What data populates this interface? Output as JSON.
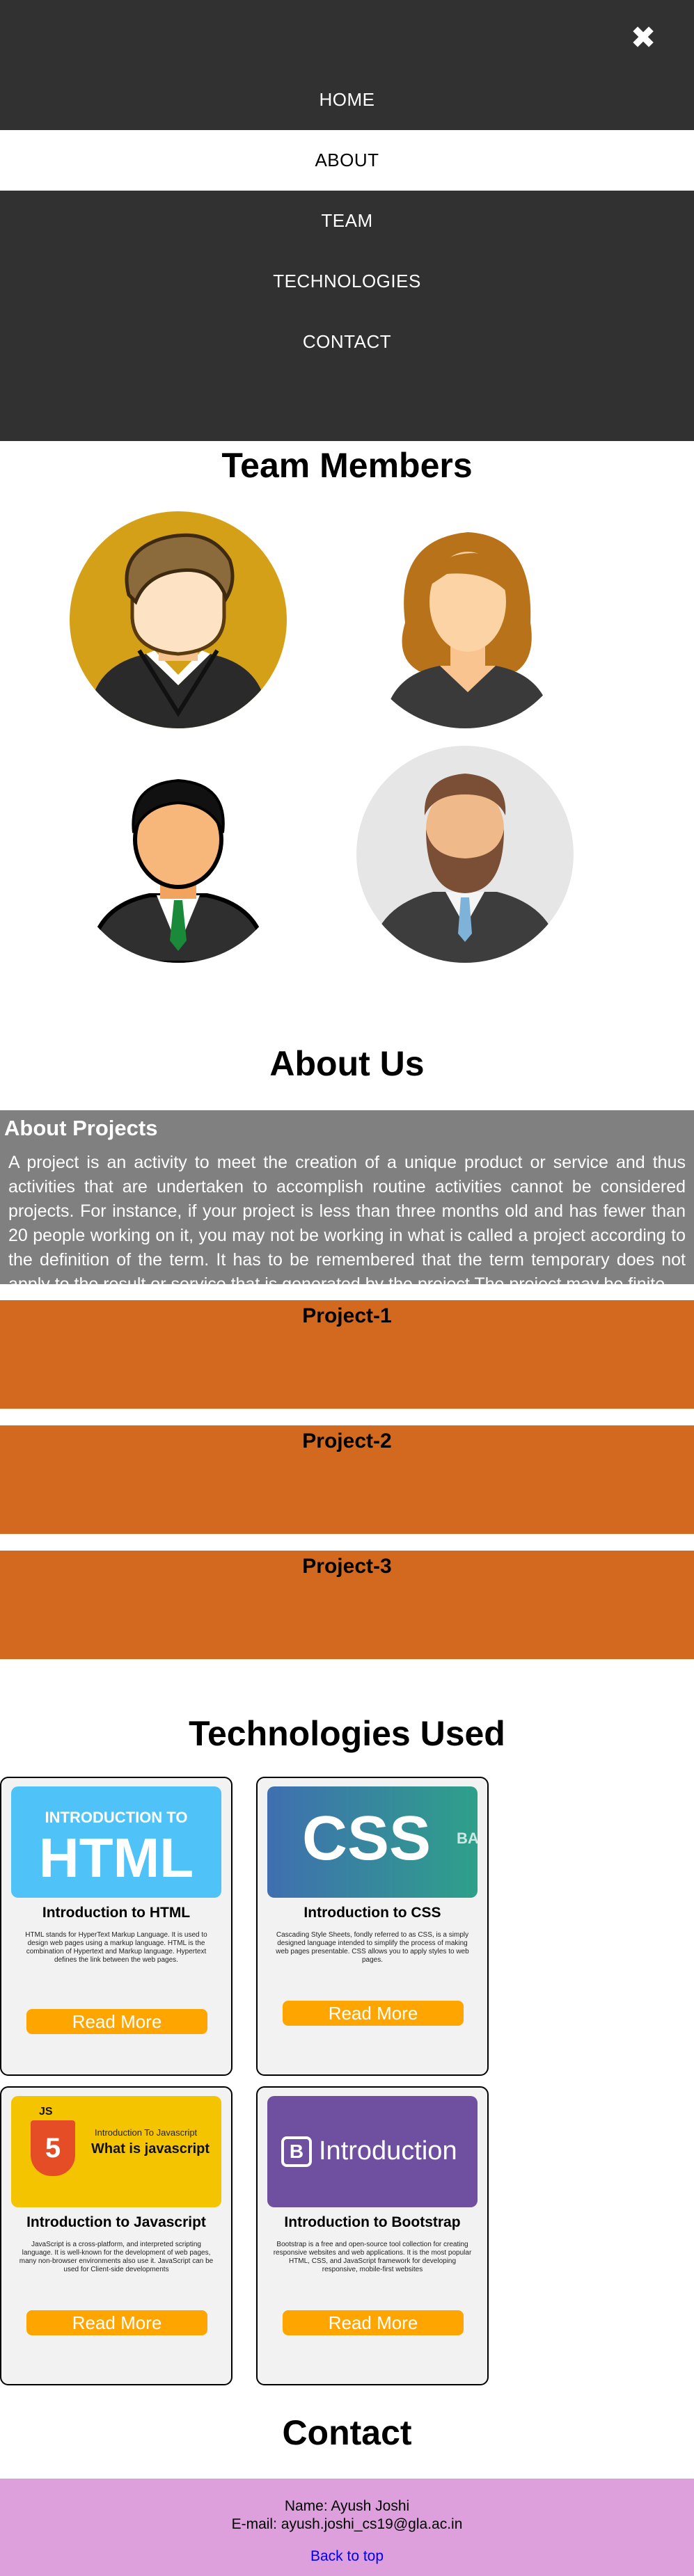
{
  "nav": {
    "close_icon": "close-icon",
    "items": [
      {
        "label": "HOME"
      },
      {
        "label": "ABOUT",
        "active": true
      },
      {
        "label": "TEAM"
      },
      {
        "label": "TECHNOLOGIES"
      },
      {
        "label": "CONTACT"
      }
    ]
  },
  "team": {
    "title": "Team Members",
    "members": [
      {
        "icon": "male-avatar-icon"
      },
      {
        "icon": "female-avatar-icon"
      },
      {
        "icon": "businessman-avatar-icon"
      },
      {
        "icon": "bearded-man-avatar-icon"
      }
    ]
  },
  "about": {
    "title": "About Us",
    "box_title": "About Projects",
    "text": "A project is an activity to meet the creation of a unique product or service and thus activities that are undertaken to accomplish routine activities cannot be considered projects. For instance, if your project is less than three months old and has fewer than 20 people working on it, you may not be working in what is called a project according to the definition of the term. It has to be remembered that the term temporary does not apply to the result or service that is generated by the project The project may be finite",
    "projects": [
      "Project-1",
      "Project-2",
      "Project-3"
    ]
  },
  "tech": {
    "title": "Technologies Used",
    "cards": [
      {
        "thumb_line1": "INTRODUCTION TO",
        "thumb_line2": "HTML",
        "title": "Introduction to HTML",
        "desc": "HTML stands for HyperText Markup Language. It is used to design web pages using a markup language. HTML is the combination of Hypertext and Markup language. Hypertext defines the link between the web pages.",
        "button": "Read More"
      },
      {
        "thumb_line1": "CSS",
        "thumb_line2": "BA",
        "title": "Introduction to CSS",
        "desc": "Cascading Style Sheets, fondly referred to as CSS, is a simply designed language intended to simplify the process of making web pages presentable. CSS allows you to apply styles to web pages.",
        "button": "Read More"
      },
      {
        "thumb_badge": "JS",
        "thumb_line1": "Introduction To Javascript",
        "thumb_line2": "What is javascript",
        "title": "Introduction to Javascript",
        "desc": "JavaScript is a cross-platform, and interpreted scripting language. It is well-known for the development of web pages, many non-browser environments also use it. JavaScript can be used for Client-side developments",
        "button": "Read More"
      },
      {
        "thumb_badge": "B",
        "thumb_line1": "Introduction",
        "title": "Introduction to Bootstrap",
        "desc": "Bootstrap is a free and open-source tool collection for creating responsive websites and web applications. It is the most popular HTML, CSS, and JavaScript framework for developing responsive, mobile-first websites",
        "button": "Read More"
      }
    ]
  },
  "contact": {
    "title": "Contact",
    "name": "Name: Ayush Joshi",
    "email": "E-mail: ayush.joshi_cs19@gla.ac.in",
    "back_link": "Back to top"
  }
}
